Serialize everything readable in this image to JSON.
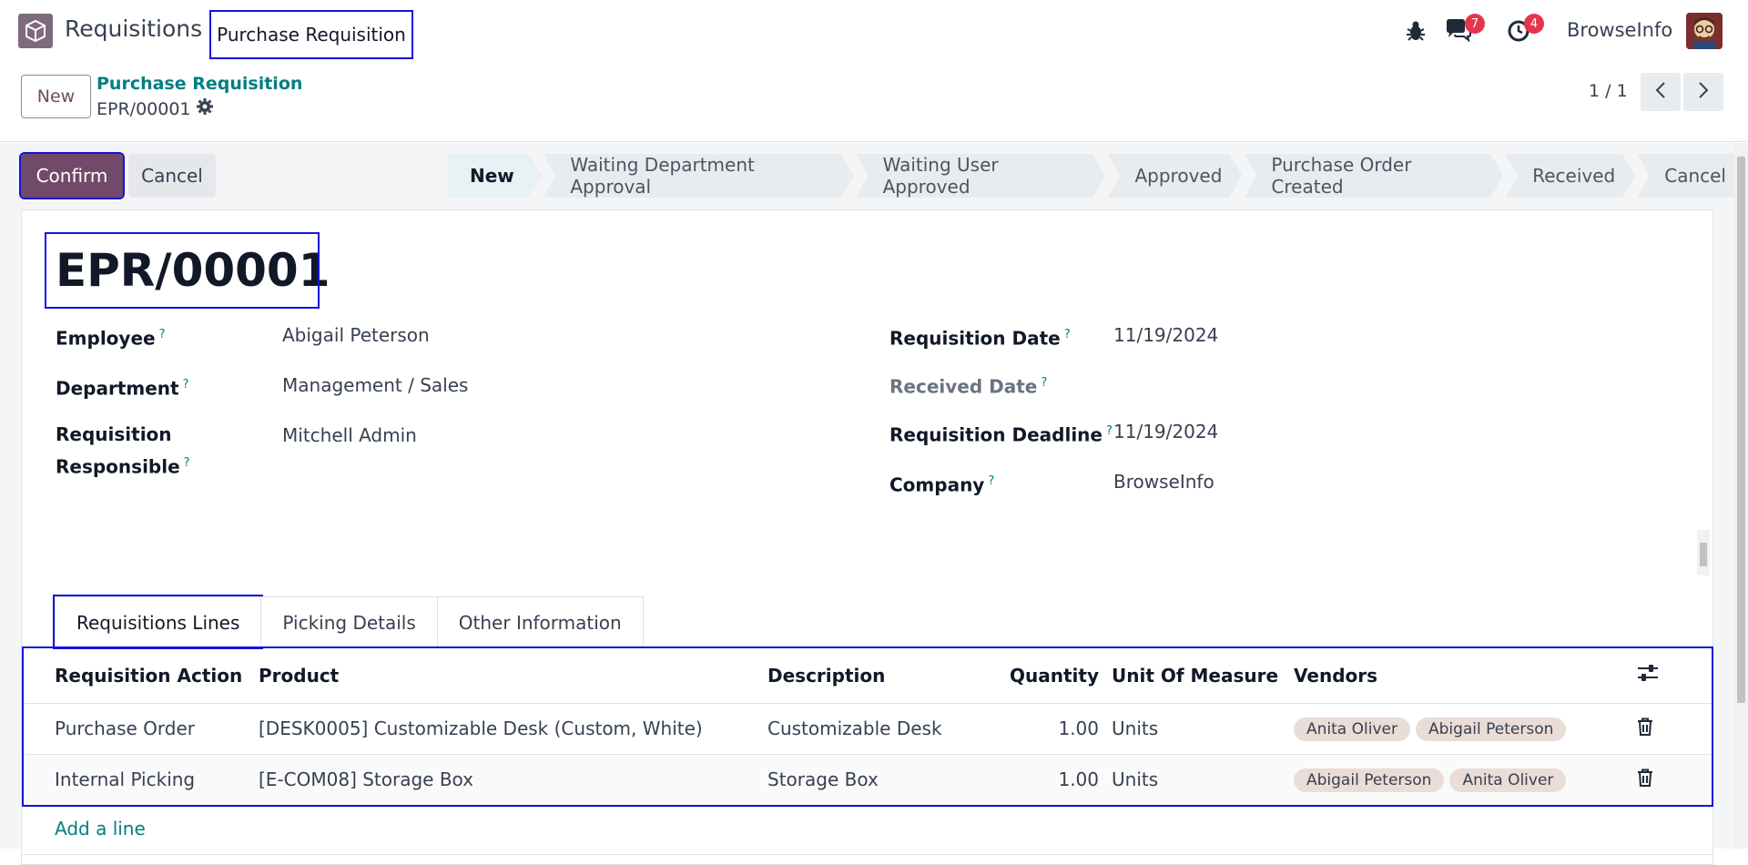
{
  "navbar": {
    "app_name": "Requisitions",
    "menu_item": "Purchase Requisition",
    "messages_count": "7",
    "activities_count": "4",
    "company": "BrowseInfo"
  },
  "control_panel": {
    "new_label": "New",
    "breadcrumb_parent": "Purchase Requisition",
    "breadcrumb_current": "EPR/00001",
    "pager": "1 / 1"
  },
  "actions": {
    "confirm_label": "Confirm",
    "cancel_label": "Cancel"
  },
  "statusbar": [
    {
      "label": "New",
      "active": true
    },
    {
      "label": "Waiting Department Approval",
      "active": false
    },
    {
      "label": "Waiting User Approved",
      "active": false
    },
    {
      "label": "Approved",
      "active": false
    },
    {
      "label": "Purchase Order Created",
      "active": false
    },
    {
      "label": "Received",
      "active": false
    },
    {
      "label": "Cancel",
      "active": false
    }
  ],
  "record": {
    "title": "EPR/00001",
    "employee_label": "Employee",
    "employee": "Abigail Peterson",
    "department_label": "Department",
    "department": "Management / Sales",
    "responsible_label_1": "Requisition",
    "responsible_label_2": "Responsible",
    "responsible": "Mitchell Admin",
    "req_date_label": "Requisition Date",
    "req_date": "11/19/2024",
    "received_date_label": "Received Date",
    "deadline_label": "Requisition Deadline",
    "deadline": "11/19/2024",
    "company_label": "Company",
    "company": "BrowseInfo",
    "help_mark": "?"
  },
  "tabs": [
    "Requisitions Lines",
    "Picking Details",
    "Other Information"
  ],
  "lines": {
    "headers": [
      "Requisition Action",
      "Product",
      "Description",
      "Quantity",
      "Unit Of Measure",
      "Vendors"
    ],
    "rows": [
      {
        "action": "Purchase Order",
        "product": "[DESK0005] Customizable Desk (Custom, White)",
        "description": "Customizable Desk",
        "quantity": "1.00",
        "uom": "Units",
        "vendors": [
          "Anita Oliver",
          "Abigail Peterson"
        ]
      },
      {
        "action": "Internal Picking",
        "product": "[E-COM08] Storage Box",
        "description": "Storage Box",
        "quantity": "1.00",
        "uom": "Units",
        "vendors": [
          "Abigail Peterson",
          "Anita Oliver"
        ]
      }
    ],
    "add_line": "Add a line"
  },
  "colors": {
    "brand": "#71496a",
    "link": "#017e84",
    "badge": "#e5354b",
    "highlight": "#1414d8"
  }
}
